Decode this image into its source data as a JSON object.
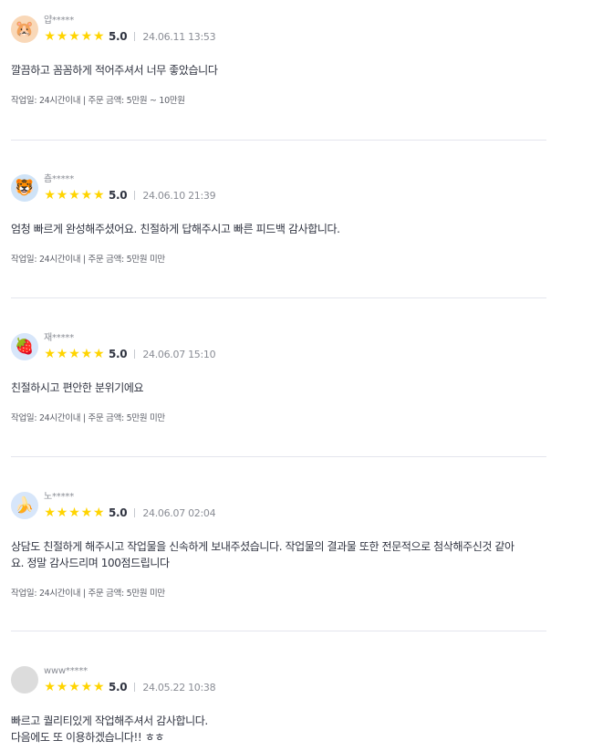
{
  "colors": {
    "star": "#ffd400",
    "divider": "#e4e5ed",
    "muted": "#8a8d95",
    "text": "#303441"
  },
  "reviews": [
    {
      "username": "얍*****",
      "avatar_icon": "hamster-avatar-icon",
      "avatar_glyph": "🐹",
      "avatar_bg": "#f9d8b8",
      "stars": "★★★★★",
      "rating": 5,
      "score": "5.0",
      "date": "24.06.11 13:53",
      "content": "깔끔하고 꼼꼼하게 적어주셔서 너무 좋았습니다",
      "info": "작업일: 24시간이내 | 주문 금액: 5만원 ~ 10만원"
    },
    {
      "username": "춈*****",
      "avatar_icon": "tiger-avatar-icon",
      "avatar_glyph": "🐯",
      "avatar_bg": "#cfe3f7",
      "stars": "★★★★★",
      "rating": 5,
      "score": "5.0",
      "date": "24.06.10 21:39",
      "content": "엄청 빠르게 완성해주셨어요. 친절하게 답해주시고 빠른 피드백 감사합니다.",
      "info": "작업일: 24시간이내 | 주문 금액: 5만원 미만"
    },
    {
      "username": "재*****",
      "avatar_icon": "fruit-avatar-icon",
      "avatar_glyph": "🍓",
      "avatar_bg": "#d7e6fa",
      "stars": "★★★★★",
      "rating": 5,
      "score": "5.0",
      "date": "24.06.07 15:10",
      "content": "친절하시고 편안한 분위기에요",
      "info": "작업일: 24시간이내 | 주문 금액: 5만원 미만"
    },
    {
      "username": "노*****",
      "avatar_icon": "banana-avatar-icon",
      "avatar_glyph": "🍌",
      "avatar_bg": "#d7e6fa",
      "stars": "★★★★★",
      "rating": 5,
      "score": "5.0",
      "date": "24.06.07 02:04",
      "content": "상담도 친절하게 해주시고 작업물을 신속하게 보내주셨습니다. 작업물의 결과물 또한 전문적으로 첨삭해주신것 같아\n요. 정말 감사드리며 100점드립니다",
      "info": "작업일: 24시간이내 | 주문 금액: 5만원 미만"
    },
    {
      "username": "www*****",
      "avatar_icon": "default-avatar-icon",
      "avatar_glyph": "",
      "avatar_bg": "#dcdcdc",
      "stars": "★★★★★",
      "rating": 5,
      "score": "5.0",
      "date": "24.05.22 10:38",
      "content": "빠르고 퀄리티있게 작업해주셔서 감사합니다.\n다음에도 또 이용하겠습니다!! ㅎㅎ",
      "info": ""
    }
  ]
}
